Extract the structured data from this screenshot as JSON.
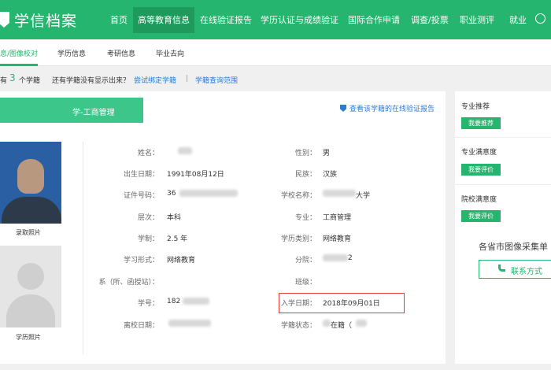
{
  "logo": {
    "text": "学信档案"
  },
  "topnav": {
    "items": [
      "首页",
      "高等教育信息",
      "在线验证报告",
      "学历认证与成绩验证",
      "国际合作申请",
      "调查/投票",
      "职业测评",
      "就业"
    ]
  },
  "subnav": {
    "items": [
      "息/图像校对",
      "学历信息",
      "考研信息",
      "毕业去向"
    ]
  },
  "infoline": {
    "prefix": "有",
    "count": "3",
    "suffix": "个学籍",
    "question": "还有学籍没有显示出来？",
    "bind_link": "尝试绑定学籍",
    "separator": "|",
    "scope_link": "学籍查询范围"
  },
  "card": {
    "banner_title": "学-工商管理",
    "verify_link": "查看该学籍的在线验证报告",
    "photo_caption_1": "录取照片",
    "photo_caption_2": "学历照片",
    "left_fields": [
      {
        "label": "姓名：",
        "value": ""
      },
      {
        "label": "出生日期：",
        "value": "1991年08月12日"
      },
      {
        "label": "证件号码：",
        "value": "36"
      },
      {
        "label": "层次：",
        "value": "本科"
      },
      {
        "label": "学制：",
        "value": "2.5 年"
      },
      {
        "label": "学习形式：",
        "value": "网络教育"
      },
      {
        "label": "系（所、函授站）：",
        "value": ""
      },
      {
        "label": "学号：",
        "value": "182"
      },
      {
        "label": "离校日期：",
        "value": ""
      }
    ],
    "right_fields": [
      {
        "label": "性别：",
        "value": "男"
      },
      {
        "label": "民族：",
        "value": "汉族"
      },
      {
        "label": "学校名称：",
        "value": "大学"
      },
      {
        "label": "专业：",
        "value": "工商管理"
      },
      {
        "label": "学历类别：",
        "value": "网络教育"
      },
      {
        "label": "分院：",
        "value": "2"
      },
      {
        "label": "班级：",
        "value": ""
      },
      {
        "label": "入学日期：",
        "value": "2018年09月01日"
      },
      {
        "label": "学籍状态：",
        "value": "在籍（"
      }
    ]
  },
  "sidebar": {
    "sections": [
      {
        "title": "专业推荐",
        "button": "我要推荐"
      },
      {
        "title": "专业满意度",
        "button": "我要评价"
      },
      {
        "title": "院校满意度",
        "button": "我要评价"
      }
    ],
    "collect_text": "各省市图像采集单",
    "contact_button": "联系方式"
  },
  "colors": {
    "brand": "#26b56e",
    "link": "#2b7bd3",
    "highlight": "#e03c31"
  }
}
